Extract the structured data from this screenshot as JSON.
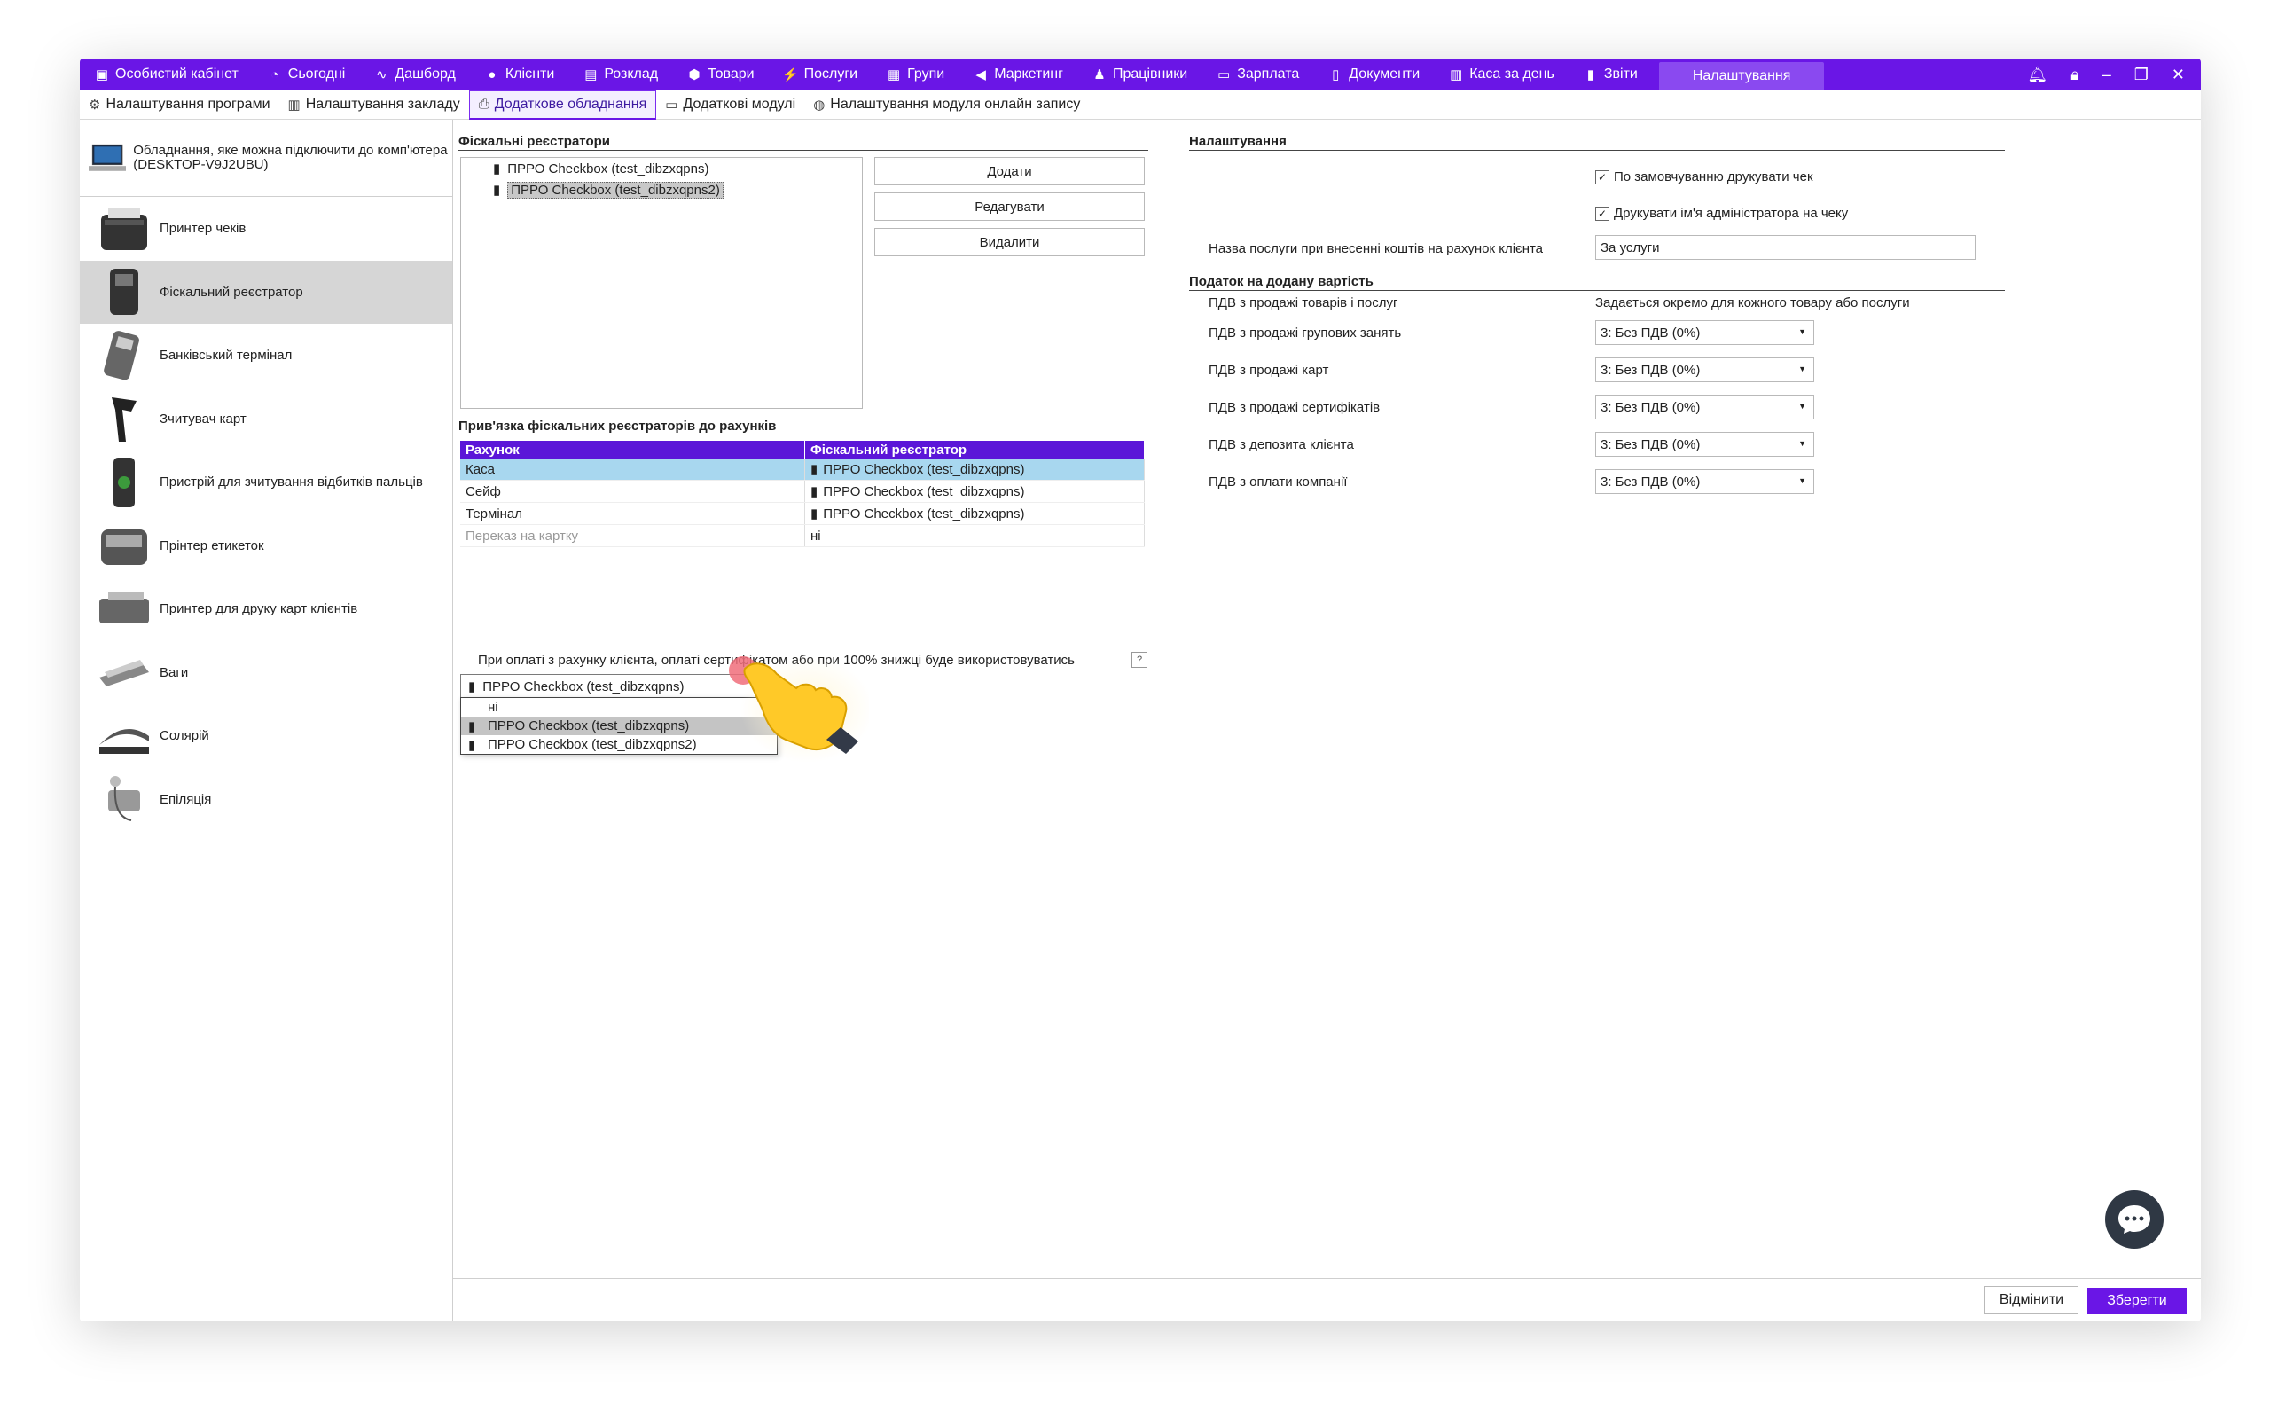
{
  "topnav": {
    "items": [
      {
        "label": "Особистий кабінет",
        "icon": "briefcase-icon"
      },
      {
        "label": "Сьогодні",
        "icon": "clock-icon"
      },
      {
        "label": "Дашборд",
        "icon": "pulse-icon"
      },
      {
        "label": "Клієнти",
        "icon": "user-circle-icon"
      },
      {
        "label": "Розклад",
        "icon": "calendar-icon"
      },
      {
        "label": "Товари",
        "icon": "box-icon"
      },
      {
        "label": "Послуги",
        "icon": "lightning-icon"
      },
      {
        "label": "Групи",
        "icon": "group-icon"
      },
      {
        "label": "Маркетинг",
        "icon": "megaphone-icon"
      },
      {
        "label": "Працівники",
        "icon": "person-icon"
      },
      {
        "label": "Зарплата",
        "icon": "money-icon"
      },
      {
        "label": "Документи",
        "icon": "document-icon"
      },
      {
        "label": "Каса за день",
        "icon": "calculator-icon"
      },
      {
        "label": "Звіти",
        "icon": "bar-chart-icon"
      }
    ],
    "active": "Налаштування"
  },
  "subtabs": [
    {
      "label": "Налаштування програми",
      "icon": "gear-icon"
    },
    {
      "label": "Налаштування закладу",
      "icon": "building-icon"
    },
    {
      "label": "Додаткове обладнання",
      "icon": "printer-icon"
    },
    {
      "label": "Додаткові модулі",
      "icon": "module-icon"
    },
    {
      "label": "Налаштування модуля онлайн запису",
      "icon": "globe-icon"
    }
  ],
  "sidebar": {
    "header": "Обладнання, яке можна підключити до комп'ютера (DESKTOP-V9J2UBU)",
    "items": [
      {
        "label": "Принтер чеків"
      },
      {
        "label": "Фіскальний реєстратор"
      },
      {
        "label": "Банківський термінал"
      },
      {
        "label": "Зчитувач карт"
      },
      {
        "label": "Пристрій для зчитування відбитків пальців"
      },
      {
        "label": "Прінтер етикеток"
      },
      {
        "label": "Принтер для друку карт клієнтів"
      },
      {
        "label": "Ваги"
      },
      {
        "label": "Солярій"
      },
      {
        "label": "Епіляція"
      }
    ]
  },
  "fiscal": {
    "title": "Фіскальні реєстратори",
    "registers": [
      "ПРРО Checkbox (test_dibzxqpns)",
      "ПРРО Checkbox (test_dibzxqpns2)"
    ],
    "buttons": {
      "add": "Додати",
      "edit": "Редагувати",
      "delete": "Видалити"
    }
  },
  "binding": {
    "title": "Прив'язка фіскальних реєстраторів до рахунків",
    "col_account": "Рахунок",
    "col_register": "Фіскальний реєстратор",
    "rows": [
      {
        "account": "Каса",
        "register": "ПРРО Checkbox (test_dibzxqpns)"
      },
      {
        "account": "Сейф",
        "register": "ПРРО Checkbox (test_dibzxqpns)"
      },
      {
        "account": "Термінал",
        "register": "ПРРО Checkbox (test_dibzxqpns)"
      },
      {
        "account": "Переказ на картку",
        "register": "ні"
      }
    ]
  },
  "payment": {
    "label": "При оплаті з рахунку клієнта, оплаті сертифікатом або при 100% знижці буде використовуватись",
    "help": "?",
    "selected": "ПРРО Checkbox (test_dibzxqpns)",
    "options": [
      "ні",
      "ПРРО Checkbox (test_dibzxqpns)",
      "ПРРО Checkbox (test_dibzxqpns2)"
    ]
  },
  "settings": {
    "title": "Налаштування",
    "check_print": "По замовчуванню друкувати чек",
    "check_admin": "Друкувати ім'я адміністратора на чеку",
    "service_label": "Назва послуги при внесенні коштів на рахунок клієнта",
    "service_value": "За услуги"
  },
  "vat": {
    "title": "Податок на додану вартість",
    "goods_label": "ПДВ з продажі товарів і послуг",
    "goods_value": "Задається окремо для кожного товару або послуги",
    "rows": [
      {
        "label": "ПДВ з продажі групових занять",
        "value": "3: Без ПДВ (0%)"
      },
      {
        "label": "ПДВ з продажі карт",
        "value": "3: Без ПДВ (0%)"
      },
      {
        "label": "ПДВ з продажі сертифікатів",
        "value": "3: Без ПДВ (0%)"
      },
      {
        "label": "ПДВ з депозита клієнта",
        "value": "3: Без ПДВ (0%)"
      },
      {
        "label": "ПДВ з оплати компанії",
        "value": "3: Без ПДВ (0%)"
      }
    ]
  },
  "footer": {
    "cancel": "Відмінити",
    "save": "Зберегти"
  },
  "colors": {
    "accent": "#6a16e6",
    "selected_row": "#a8d7ef"
  }
}
